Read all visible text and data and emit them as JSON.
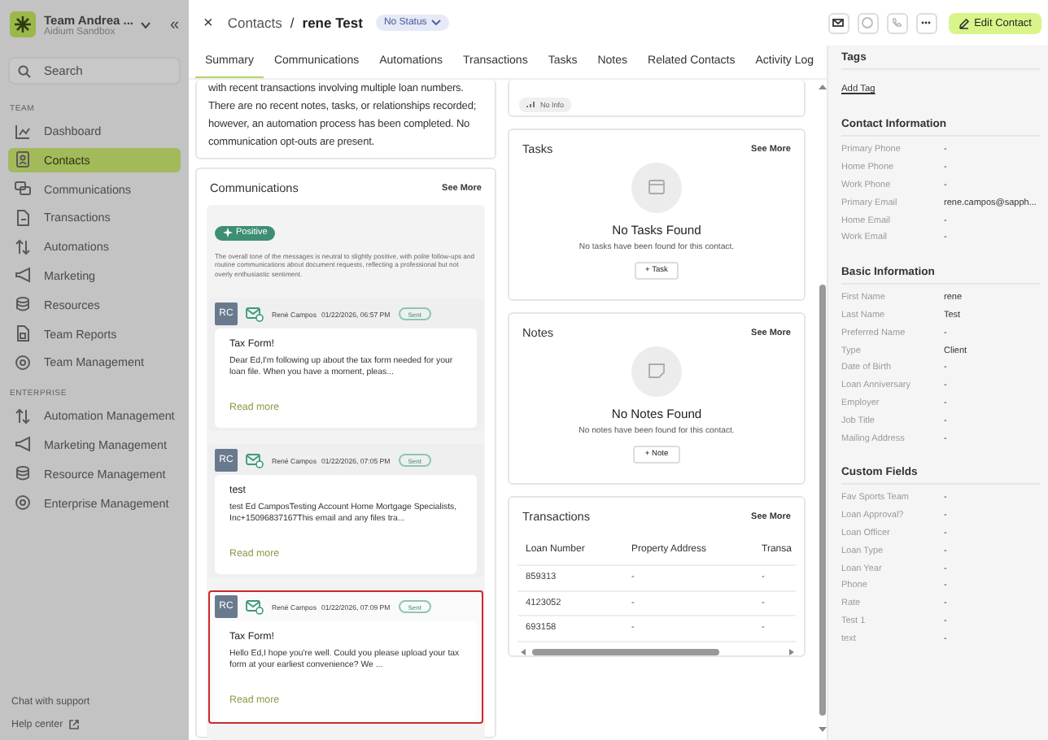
{
  "sidebar": {
    "team_name": "Team Andrea ...",
    "team_subtitle": "Aidium Sandbox",
    "collapse": "«",
    "search": {
      "placeholder": "Search"
    },
    "sections": [
      {
        "label": "TEAM",
        "items": [
          {
            "label": "Dashboard",
            "selected": false
          },
          {
            "label": "Contacts",
            "selected": true
          },
          {
            "label": "Communications",
            "selected": false
          },
          {
            "label": "Transactions",
            "selected": false
          },
          {
            "label": "Automations",
            "selected": false
          },
          {
            "label": "Marketing",
            "selected": false
          },
          {
            "label": "Resources",
            "selected": false
          },
          {
            "label": "Team Reports",
            "selected": false
          },
          {
            "label": "Team Management",
            "selected": false
          }
        ]
      },
      {
        "label": "ENTERPRISE",
        "items": [
          {
            "label": "Automation Management",
            "selected": false
          },
          {
            "label": "Marketing Management",
            "selected": false
          },
          {
            "label": "Resource Management",
            "selected": false
          },
          {
            "label": "Enterprise Management",
            "selected": false
          }
        ]
      }
    ],
    "footer_links": [
      "Chat with support",
      "Help center"
    ]
  },
  "header": {
    "close": "×",
    "breadcrumb": "Contacts",
    "separator": "/",
    "title": "rene Test",
    "status": "No Status",
    "edit_button": "Edit Contact"
  },
  "tabs": [
    {
      "label": "Summary",
      "selected": true
    },
    {
      "label": "Communications",
      "selected": false
    },
    {
      "label": "Automations",
      "selected": false
    },
    {
      "label": "Transactions",
      "selected": false
    },
    {
      "label": "Tasks",
      "selected": false
    },
    {
      "label": "Notes",
      "selected": false
    },
    {
      "label": "Related Contacts",
      "selected": false
    },
    {
      "label": "Activity Log",
      "selected": false
    }
  ],
  "summary": {
    "text": "with recent transactions involving multiple loan numbers. There are no recent notes, tasks, or relationships recorded; however, an automation process has been completed. No communication opt-outs are present."
  },
  "communications": {
    "title": "Communications",
    "see_more": "See More",
    "sentiment": {
      "label": "Positive",
      "description": "The overall tone of the messages is neutral to slightly positive, with polite follow-ups and routine communications about document requests, reflecting a professional but not overly enthusiastic sentiment."
    },
    "messages": [
      {
        "initials": "RC",
        "sender": "René Campos",
        "time": "01/22/2026, 06:57 PM",
        "status": "Sent",
        "subject": "Tax Form!",
        "preview": "Dear Ed,I'm following up about the tax form needed for your loan file. When you have a moment, pleas...",
        "read_more": "Read more",
        "highlighted": false
      },
      {
        "initials": "RC",
        "sender": "René Campos",
        "time": "01/22/2026, 07:05 PM",
        "status": "Sent",
        "subject": "test",
        "preview": "test Ed CamposTesting Account Home Mortgage Specialists, Inc+15096837167This email and any files tra...",
        "read_more": "Read more",
        "highlighted": false
      },
      {
        "initials": "RC",
        "sender": "René Campos",
        "time": "01/22/2026, 07:09 PM",
        "status": "Sent",
        "subject": "Tax Form!",
        "preview": "Hello Ed,I hope you're well. Could you please upload your tax form at your earliest convenience? We ...",
        "read_more": "Read more",
        "highlighted": true
      }
    ]
  },
  "info_badge": "No Info",
  "tasks": {
    "title": "Tasks",
    "see_more": "See More",
    "empty_title": "No Tasks Found",
    "empty_text": "No tasks have been found for this contact.",
    "add_button": "+ Task"
  },
  "notes": {
    "title": "Notes",
    "see_more": "See More",
    "empty_title": "No Notes Found",
    "empty_text": "No notes have been found for this contact.",
    "add_button": "+ Note"
  },
  "transactions": {
    "title": "Transactions",
    "see_more": "See More",
    "columns": [
      "Loan Number",
      "Property Address",
      "Transa"
    ],
    "rows": [
      [
        "859313",
        "-",
        "-"
      ],
      [
        "4123052",
        "-",
        "-"
      ],
      [
        "693158",
        "-",
        "-"
      ]
    ]
  },
  "details": {
    "tags_title": "Tags",
    "add_tag": "Add Tag",
    "sections": [
      {
        "title": "Contact Information",
        "fields": [
          {
            "label": "Primary Phone",
            "value": "-"
          },
          {
            "label": "Home Phone",
            "value": "-"
          },
          {
            "label": "Work Phone",
            "value": "-"
          },
          {
            "label": "Primary Email",
            "value": "rene.campos@sapph..."
          },
          {
            "label": "Home Email",
            "value": "-"
          },
          {
            "label": "Work Email",
            "value": "-"
          }
        ]
      },
      {
        "title": "Basic Information",
        "fields": [
          {
            "label": "First Name",
            "value": "rene"
          },
          {
            "label": "Last Name",
            "value": "Test"
          },
          {
            "label": "Preferred Name",
            "value": "-"
          },
          {
            "label": "Type",
            "value": "Client"
          },
          {
            "label": "Date of Birth",
            "value": "-"
          },
          {
            "label": "Loan Anniversary",
            "value": "-"
          },
          {
            "label": "Employer",
            "value": "-"
          },
          {
            "label": "Job Title",
            "value": "-"
          },
          {
            "label": "Mailing Address",
            "value": "-"
          }
        ]
      },
      {
        "title": "Custom Fields",
        "fields": [
          {
            "label": "Fav Sports Team",
            "value": "-"
          },
          {
            "label": "Loan Approval?",
            "value": "-"
          },
          {
            "label": "Loan Officer",
            "value": "-"
          },
          {
            "label": "Loan Type",
            "value": "-"
          },
          {
            "label": "Loan Year",
            "value": "-"
          },
          {
            "label": "Phone",
            "value": "-"
          },
          {
            "label": "Rate",
            "value": "-"
          },
          {
            "label": "Test 1",
            "value": "-"
          },
          {
            "label": "text",
            "value": "-"
          }
        ]
      }
    ]
  }
}
